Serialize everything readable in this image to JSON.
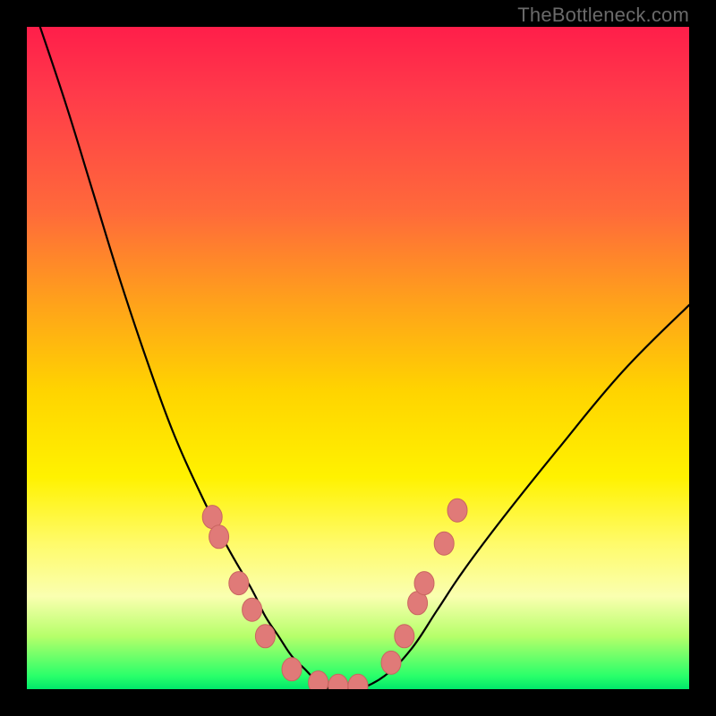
{
  "watermark": "TheBottleneck.com",
  "colors": {
    "curve_stroke": "#000000",
    "marker_fill": "#e07a78",
    "marker_stroke": "#c96560"
  },
  "chart_data": {
    "type": "line",
    "title": "",
    "xlabel": "",
    "ylabel": "",
    "xlim": [
      0,
      100
    ],
    "ylim": [
      0,
      100
    ],
    "series": [
      {
        "name": "bottleneck_curve",
        "x": [
          2,
          6,
          10,
          14,
          18,
          22,
          26,
          30,
          34,
          36,
          38,
          40,
          42,
          44,
          46,
          48,
          50,
          54,
          58,
          62,
          66,
          72,
          80,
          90,
          100
        ],
        "y": [
          100,
          88,
          75,
          62,
          50,
          39,
          30,
          22,
          15,
          11,
          8,
          5,
          3,
          1,
          0,
          0,
          0,
          2,
          6,
          12,
          18,
          26,
          36,
          48,
          58
        ]
      }
    ],
    "markers": [
      {
        "x": 28,
        "y": 26
      },
      {
        "x": 29,
        "y": 23
      },
      {
        "x": 32,
        "y": 16
      },
      {
        "x": 34,
        "y": 12
      },
      {
        "x": 36,
        "y": 8
      },
      {
        "x": 40,
        "y": 3
      },
      {
        "x": 44,
        "y": 1
      },
      {
        "x": 47,
        "y": 0.5
      },
      {
        "x": 50,
        "y": 0.5
      },
      {
        "x": 55,
        "y": 4
      },
      {
        "x": 57,
        "y": 8
      },
      {
        "x": 59,
        "y": 13
      },
      {
        "x": 60,
        "y": 16
      },
      {
        "x": 63,
        "y": 22
      },
      {
        "x": 65,
        "y": 27
      }
    ]
  }
}
